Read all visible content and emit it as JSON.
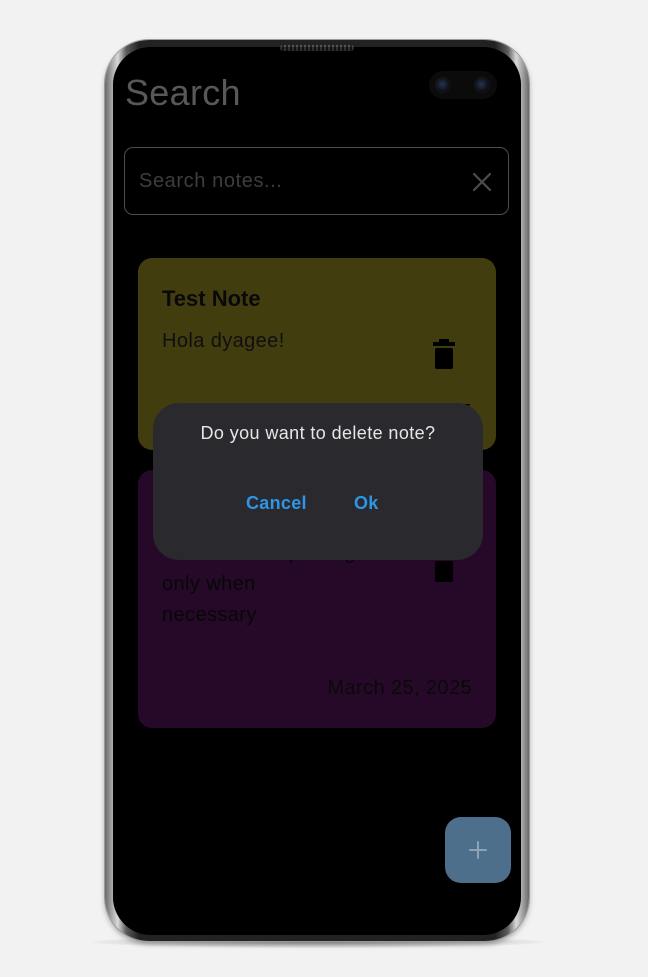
{
  "header": {
    "title": "Search"
  },
  "search": {
    "placeholder": "Search notes..."
  },
  "notes": [
    {
      "title": "Test Note",
      "body": "Hola dyagee!",
      "date": "5",
      "color": "#78701d"
    },
    {
      "title": "",
      "body": "-use external packages\nonly when\nnecessary",
      "date": "March 25, 2025",
      "color": "#45124a"
    }
  ],
  "dialog": {
    "message": "Do you want to delete note?",
    "cancel_label": "Cancel",
    "ok_label": "Ok",
    "accent_color": "#2e96e6"
  },
  "fab": {
    "icon": "plus-icon",
    "color": "#4e6f8c"
  },
  "icons": {
    "clear": "close-icon",
    "delete": "trash-icon"
  }
}
